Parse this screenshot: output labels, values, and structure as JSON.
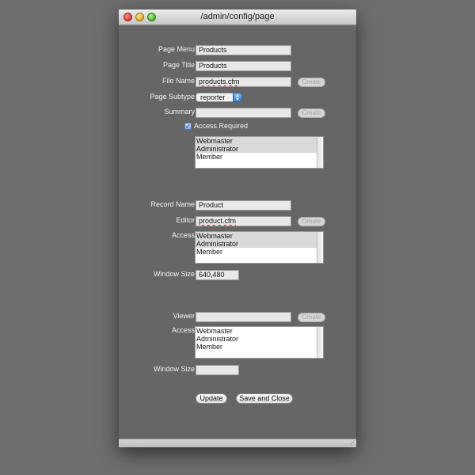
{
  "window": {
    "title": "/admin/config/page"
  },
  "page": {
    "page_menu": {
      "label": "Page Menu",
      "value": "Products"
    },
    "page_title": {
      "label": "Page Title",
      "value": "Products"
    },
    "file_name": {
      "label": "File Name",
      "value": "products.cfm",
      "button": "Create"
    },
    "page_subtype": {
      "label": "Page Subtype",
      "value": "reporter"
    },
    "summary": {
      "label": "Summary",
      "value": "",
      "button": "Create"
    },
    "access_required": {
      "label": "Access Required",
      "checked": true
    },
    "access_list": {
      "options": [
        {
          "label": "Webmaster",
          "selected": true
        },
        {
          "label": "Administrator",
          "selected": true
        },
        {
          "label": "Member",
          "selected": false
        }
      ]
    }
  },
  "record": {
    "record_name": {
      "label": "Record Name",
      "value": "Product"
    },
    "editor": {
      "label": "Editor",
      "value": "product.cfm",
      "button": "Create"
    },
    "access": {
      "label": "Access",
      "options": [
        {
          "label": "Webmaster",
          "selected": true
        },
        {
          "label": "Administrator",
          "selected": true
        },
        {
          "label": "Member",
          "selected": false
        }
      ]
    },
    "window_size": {
      "label": "Window Size",
      "value": "640,480"
    }
  },
  "viewer": {
    "viewer": {
      "label": "Viewer",
      "value": "",
      "button": "Create"
    },
    "access": {
      "label": "Access",
      "options": [
        {
          "label": "Webmaster",
          "selected": false
        },
        {
          "label": "Administrator",
          "selected": false
        },
        {
          "label": "Member",
          "selected": false
        }
      ]
    },
    "window_size": {
      "label": "Window Size",
      "value": ""
    }
  },
  "actions": {
    "update": "Update",
    "save_close": "Save and Close"
  }
}
